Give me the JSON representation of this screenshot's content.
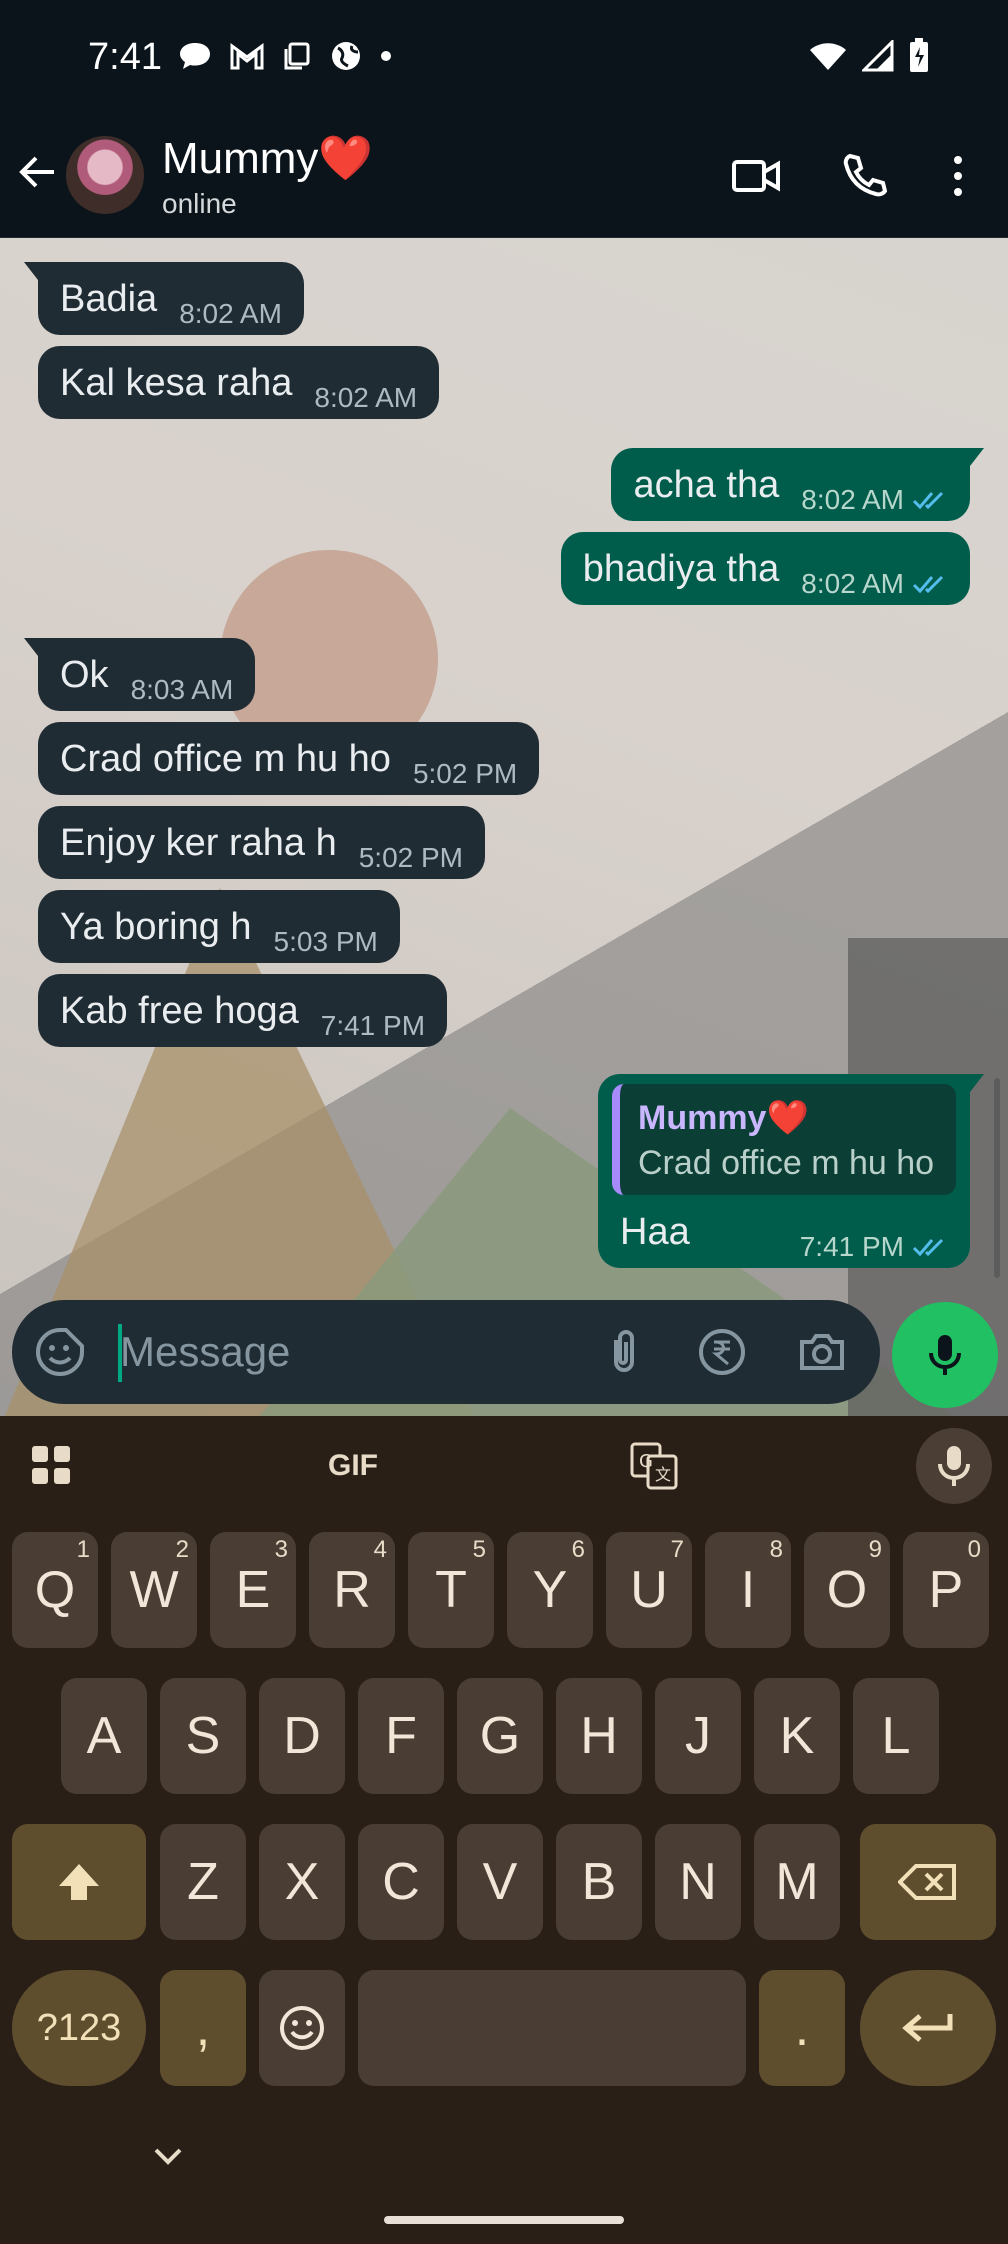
{
  "status_bar": {
    "time": "7:41"
  },
  "header": {
    "contact_name": "Mummy❤️",
    "contact_status": "online"
  },
  "messages": [
    {
      "dir": "in",
      "text": "Badia",
      "time": "8:02 AM"
    },
    {
      "dir": "in",
      "text": "Kal kesa raha",
      "time": "8:02 AM"
    },
    {
      "dir": "out",
      "text": "acha tha",
      "time": "8:02 AM"
    },
    {
      "dir": "out",
      "text": "bhadiya tha",
      "time": "8:02 AM"
    },
    {
      "dir": "in",
      "text": "Ok",
      "time": "8:03 AM"
    },
    {
      "dir": "in",
      "text": "Crad office m hu ho",
      "time": "5:02 PM"
    },
    {
      "dir": "in",
      "text": "Enjoy ker raha h",
      "time": "5:02 PM"
    },
    {
      "dir": "in",
      "text": "Ya boring h",
      "time": "5:03 PM"
    },
    {
      "dir": "in",
      "text": "Kab free hoga",
      "time": "7:41 PM"
    },
    {
      "dir": "out",
      "reply_to_name": "Mummy❤️",
      "reply_to_text": "Crad office m hu ho",
      "text": "Haa",
      "time": "7:41 PM"
    }
  ],
  "composer": {
    "placeholder": "Message"
  },
  "keyboard": {
    "gif_label": "GIF",
    "row1": [
      {
        "k": "Q",
        "h": "1"
      },
      {
        "k": "W",
        "h": "2"
      },
      {
        "k": "E",
        "h": "3"
      },
      {
        "k": "R",
        "h": "4"
      },
      {
        "k": "T",
        "h": "5"
      },
      {
        "k": "Y",
        "h": "6"
      },
      {
        "k": "U",
        "h": "7"
      },
      {
        "k": "I",
        "h": "8"
      },
      {
        "k": "O",
        "h": "9"
      },
      {
        "k": "P",
        "h": "0"
      }
    ],
    "row2": [
      "A",
      "S",
      "D",
      "F",
      "G",
      "H",
      "J",
      "K",
      "L"
    ],
    "row3": [
      "Z",
      "X",
      "C",
      "V",
      "B",
      "N",
      "M"
    ],
    "symbols_label": "?123",
    "comma_label": ",",
    "period_label": "."
  },
  "colors": {
    "incoming_bubble": "#1f2c34",
    "outgoing_bubble": "#005c4b",
    "accent_green": "#21c063",
    "read_ticks": "#53bdeb"
  }
}
